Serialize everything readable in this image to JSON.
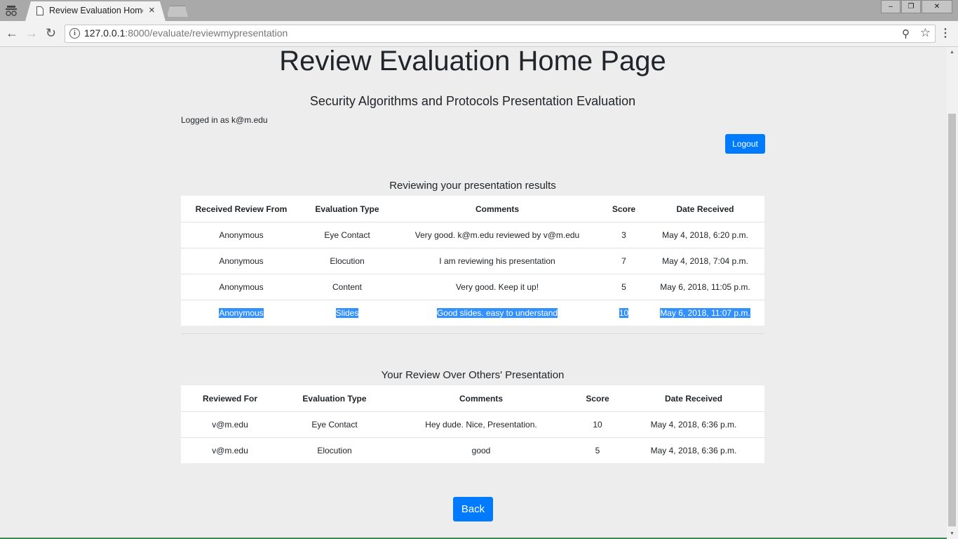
{
  "browser": {
    "tab_title": "Review Evaluation Home",
    "tab_close": "×",
    "url_host": "127.0.0.1",
    "url_rest": ":8000/evaluate/reviewmypresentation",
    "win_min": "‒",
    "win_max": "❐",
    "win_close": "✕"
  },
  "page": {
    "title": "Review Evaluation Home Page",
    "subtitle": "Security Algorithms and Protocols Presentation Evaluation",
    "logged_in": "Logged in as k@m.edu",
    "logout_label": "Logout",
    "back_label": "Back"
  },
  "received": {
    "title": "Reviewing your presentation results",
    "headers": [
      "Received Review From",
      "Evaluation Type",
      "Comments",
      "Score",
      "Date Received"
    ],
    "rows": [
      [
        "Anonymous",
        "Eye Contact",
        "Very good. k@m.edu reviewed by v@m.edu",
        "3",
        "May 4, 2018, 6:20 p.m."
      ],
      [
        "Anonymous",
        "Elocution",
        "I am reviewing his presentation",
        "7",
        "May 4, 2018, 7:04 p.m."
      ],
      [
        "Anonymous",
        "Content",
        "Very good. Keep it up!",
        "5",
        "May 6, 2018, 11:05 p.m."
      ],
      [
        "Anonymous",
        "Slides",
        "Good slides. easy to understand",
        "10",
        "May 6, 2018, 11:07 p.m."
      ]
    ]
  },
  "given": {
    "title": "Your Review Over Others' Presentation",
    "headers": [
      "Reviewed For",
      "Evaluation Type",
      "Comments",
      "Score",
      "Date Received"
    ],
    "rows": [
      [
        "v@m.edu",
        "Eye Contact",
        "Hey dude. Nice, Presentation.",
        "10",
        "May 4, 2018, 6:36 p.m."
      ],
      [
        "v@m.edu",
        "Elocution",
        "good",
        "5",
        "May 4, 2018, 6:36 p.m."
      ]
    ]
  },
  "colors": {
    "primary": "#007bff",
    "selection": "#3390ff",
    "page_bg": "#ededed"
  }
}
